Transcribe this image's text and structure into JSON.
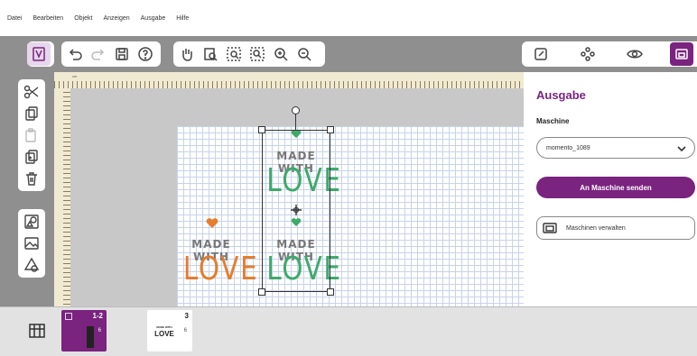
{
  "menu": [
    "Datei",
    "Bearbeiten",
    "Objekt",
    "Anzeigen",
    "Ausgabe",
    "Hilfe"
  ],
  "ruler": {
    "unit": "cm"
  },
  "design": {
    "orange": {
      "line1": "MADE WITH",
      "line2": "LOVE"
    },
    "green_top": {
      "line1": "MADE WITH",
      "line2": "LOVE"
    },
    "green_bottom": {
      "line1": "MADE WITH",
      "line2": "LOVE"
    }
  },
  "panel": {
    "title": "Ausgabe",
    "machine_label": "Maschine",
    "machine_value": "momento_1089",
    "send_label": "An Maschine senden",
    "manage_label": "Maschinen verwalten"
  },
  "mats": [
    {
      "label": "1-2",
      "count": "6"
    },
    {
      "label": "3",
      "count": "6",
      "line1": "MADE WITH",
      "line2": "LOVE"
    }
  ],
  "colors": {
    "accent": "#7a237f",
    "green": "#3daa6a",
    "orange": "#e57d2c"
  }
}
